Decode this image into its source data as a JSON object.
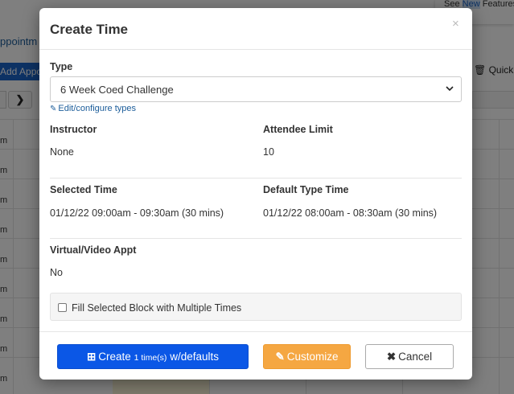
{
  "background": {
    "appointments_label": "ppointm",
    "add_button_label": "Add Appo",
    "nav_next": "❯",
    "quick_label": "Quick",
    "see_new_features": {
      "see": "See",
      "new": "New",
      "features": "Features"
    },
    "time_labels": [
      "m",
      "m",
      "m",
      "m",
      "m",
      "m",
      "m",
      "m",
      "m"
    ]
  },
  "modal": {
    "title": "Create Time",
    "close": "×",
    "type_label": "Type",
    "type_value": "6 Week Coed Challenge",
    "edit_link": "Edit/configure types",
    "instructor_label": "Instructor",
    "instructor_value": "None",
    "attendee_limit_label": "Attendee Limit",
    "attendee_limit_value": "10",
    "selected_time_label": "Selected Time",
    "selected_time_value": "01/12/22 09:00am - 09:30am (30 mins)",
    "default_type_time_label": "Default Type Time",
    "default_type_time_value": "01/12/22 08:00am - 08:30am (30 mins)",
    "virtual_label": "Virtual/Video Appt",
    "virtual_value": "No",
    "fill_block_label": "Fill Selected Block with Multiple Times"
  },
  "buttons": {
    "create_prefix": "Create",
    "create_count": "1 time(s)",
    "create_suffix": "w/defaults",
    "customize": "Customize",
    "cancel": "Cancel"
  },
  "colors": {
    "create_button": "#0b57e6",
    "customize_button": "#f5a742",
    "link": "#1c5d9a"
  },
  "icons": {
    "create": "plus-square-icon",
    "customize": "edit-icon",
    "cancel": "times-icon",
    "edit_link": "edit-icon",
    "quick": "trash-icon"
  }
}
